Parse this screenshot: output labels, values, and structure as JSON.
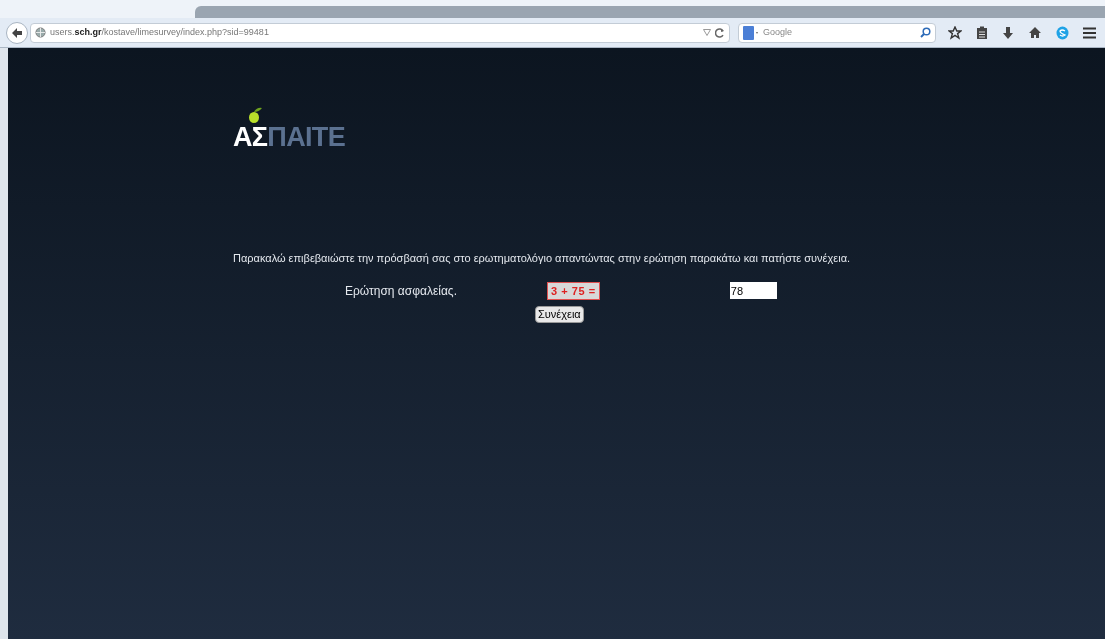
{
  "browser": {
    "url_parts": [
      "users.",
      "sch.gr",
      "/kostave/limesurvey/index.php?sid=99481"
    ],
    "search": {
      "placeholder": "Google"
    }
  },
  "page": {
    "logo": {
      "strong": "ΑΣ",
      "rest": "ΠΑΙΤΕ"
    },
    "instructions": "Παρακαλώ επιβεβαιώστε την πρόσβασή σας στο ερωτηματολόγιο απαντώντας στην ερώτηση παρακάτω και πατήστε συνέχεια.",
    "question_label": "Ερώτηση ασφαλείας.",
    "captcha": "3 + 75 =",
    "answer": "78",
    "button": "Συνέχεια"
  }
}
